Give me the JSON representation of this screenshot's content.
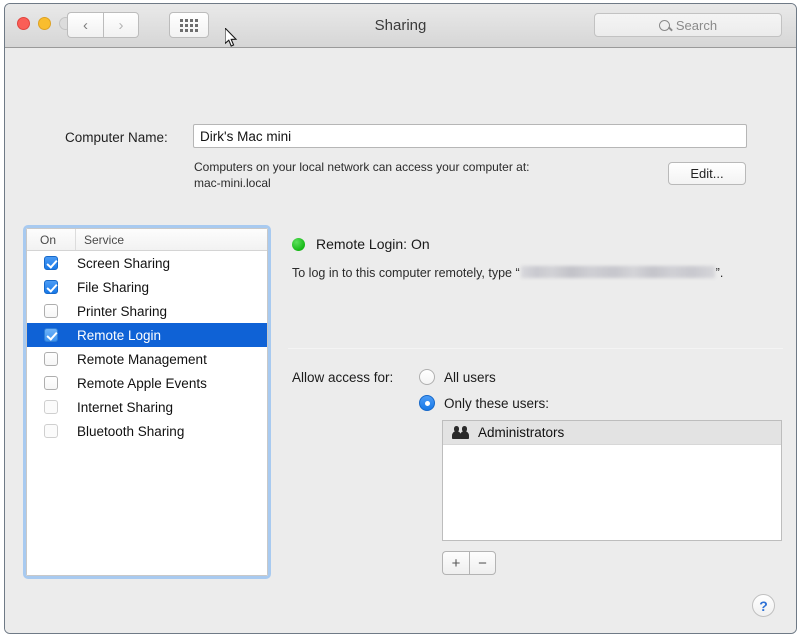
{
  "window": {
    "title": "Sharing",
    "traffic_lights": [
      "close",
      "minimize",
      "zoom-disabled"
    ],
    "nav": {
      "back": "‹",
      "forward": "›"
    },
    "grid_button": "all-preferences-grid",
    "search": {
      "placeholder": "Search",
      "value": ""
    }
  },
  "computer_name": {
    "label": "Computer Name:",
    "value": "Dirk's Mac mini",
    "note_line1": "Computers on your local network can access your computer at:",
    "note_line2": "mac-mini.local",
    "edit_label": "Edit..."
  },
  "services": {
    "columns": [
      "On",
      "Service"
    ],
    "items": [
      {
        "name": "Screen Sharing",
        "checked": true,
        "selected": false,
        "dim": false
      },
      {
        "name": "File Sharing",
        "checked": true,
        "selected": false,
        "dim": false
      },
      {
        "name": "Printer Sharing",
        "checked": false,
        "selected": false,
        "dim": false
      },
      {
        "name": "Remote Login",
        "checked": true,
        "selected": true,
        "dim": false
      },
      {
        "name": "Remote Management",
        "checked": false,
        "selected": false,
        "dim": false
      },
      {
        "name": "Remote Apple Events",
        "checked": false,
        "selected": false,
        "dim": false
      },
      {
        "name": "Internet Sharing",
        "checked": false,
        "selected": false,
        "dim": true
      },
      {
        "name": "Bluetooth Sharing",
        "checked": false,
        "selected": false,
        "dim": true
      }
    ]
  },
  "detail": {
    "status_text": "Remote Login: On",
    "status_color": "#16b816",
    "hint_prefix": "To log in to this computer remotely, type “",
    "hint_redacted": "",
    "hint_suffix": "”.",
    "allow_label": "Allow access for:",
    "radio_all_users": "All users",
    "radio_only_these": "Only these users:",
    "radio_selected": "only_these",
    "users": [
      {
        "name": "Administrators",
        "icon": "group-icon"
      }
    ],
    "add_label": "+",
    "remove_label": "−"
  },
  "help": {
    "label": "?",
    "color": "#2f72d6"
  }
}
